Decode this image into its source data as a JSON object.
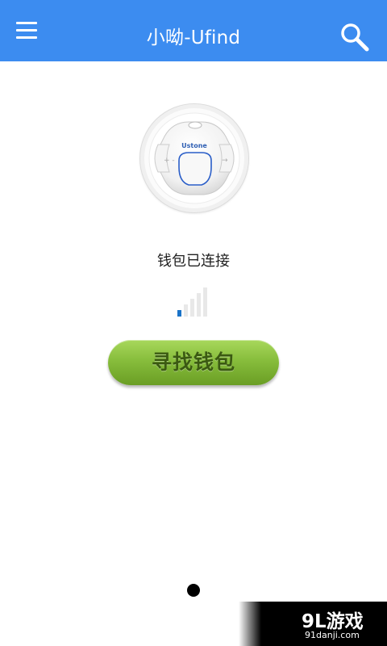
{
  "app_bar": {
    "title": "小呦-Ufind",
    "background": "#3c8cf0",
    "menu_icon": "hamburger-menu-icon",
    "search_icon": "search-icon"
  },
  "device": {
    "brand": "Ustone",
    "image": "tracker-tag-device"
  },
  "status": {
    "text": "钱包已连接",
    "signal_level": 1,
    "signal_max": 5,
    "signal_active_color": "#1a73c8"
  },
  "find_button": {
    "label": "寻找钱包",
    "color": "#87bd3c"
  },
  "pager": {
    "pages": 1,
    "current": 1
  },
  "watermark": {
    "brand": "9L游戏",
    "url": "91danji.com"
  }
}
